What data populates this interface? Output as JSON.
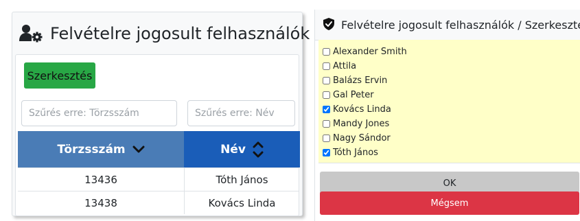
{
  "left": {
    "title": "Felvételre jogosult felhasználók",
    "edit_button": "Szerkesztés",
    "filter_id_placeholder": "Szűrés erre: Törzsszám",
    "filter_name_placeholder": "Szűrés erre: Név",
    "columns": [
      "Törzsszám",
      "Név"
    ],
    "rows": [
      {
        "id": "13436",
        "name": "Tóth János"
      },
      {
        "id": "13438",
        "name": "Kovács Linda"
      }
    ],
    "colors": {
      "header_id": "#4a7cb6",
      "header_name": "#1a5db8",
      "edit_button": "#28a745"
    }
  },
  "right": {
    "title": "Felvételre jogosult felhasználók / Szerkesztés",
    "users": [
      {
        "name": "Alexander Smith",
        "checked": false
      },
      {
        "name": "Attila",
        "checked": false
      },
      {
        "name": "Balázs Ervin",
        "checked": false
      },
      {
        "name": "Gal Peter",
        "checked": false
      },
      {
        "name": "Kovács Linda",
        "checked": true
      },
      {
        "name": "Mandy Jones",
        "checked": false
      },
      {
        "name": "Nagy Sándor",
        "checked": false
      },
      {
        "name": "Tóth János",
        "checked": true
      }
    ],
    "ok_button": "OK",
    "cancel_button": "Mégsem",
    "colors": {
      "list_background": "#ffffc8",
      "ok_button": "#c8c8c8",
      "cancel_button": "#dc3545"
    }
  },
  "icons": [
    "user-cog-icon",
    "sort-desc-icon",
    "sort-both-icon",
    "shield-check-icon"
  ]
}
